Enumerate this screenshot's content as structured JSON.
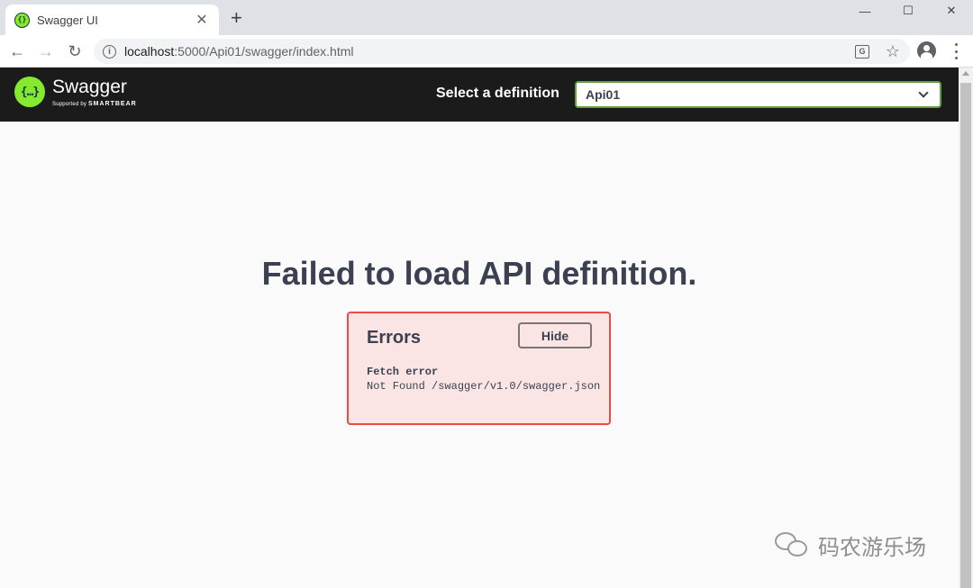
{
  "browser": {
    "tab_title": "Swagger UI",
    "url_host": "localhost",
    "url_rest": ":5000/Api01/swagger/index.html"
  },
  "topbar": {
    "logo_name": "Swagger",
    "logo_sub_prefix": "Supported by",
    "logo_sub_brand": "SMARTBEAR",
    "select_label": "Select a definition",
    "selected_definition": "Api01"
  },
  "main": {
    "title": "Failed to load API definition."
  },
  "errors": {
    "title": "Errors",
    "hide_label": "Hide",
    "error_name": "Fetch error",
    "error_message": "Not Found /swagger/v1.0/swagger.json"
  },
  "watermark": {
    "text": "码农游乐场"
  },
  "colors": {
    "swagger_green": "#85ea2d",
    "topbar_bg": "#1b1b1b",
    "select_border": "#62a03f",
    "error_border": "#e94a4a",
    "error_bg": "#fae4e4",
    "text_dark": "#3b4151"
  },
  "icons": {
    "back": "arrow-left-icon",
    "forward": "arrow-right-icon",
    "reload": "reload-icon",
    "info": "info-icon",
    "translate": "translate-icon",
    "bookmark": "star-icon",
    "profile": "profile-icon",
    "menu": "kebab-menu-icon"
  }
}
